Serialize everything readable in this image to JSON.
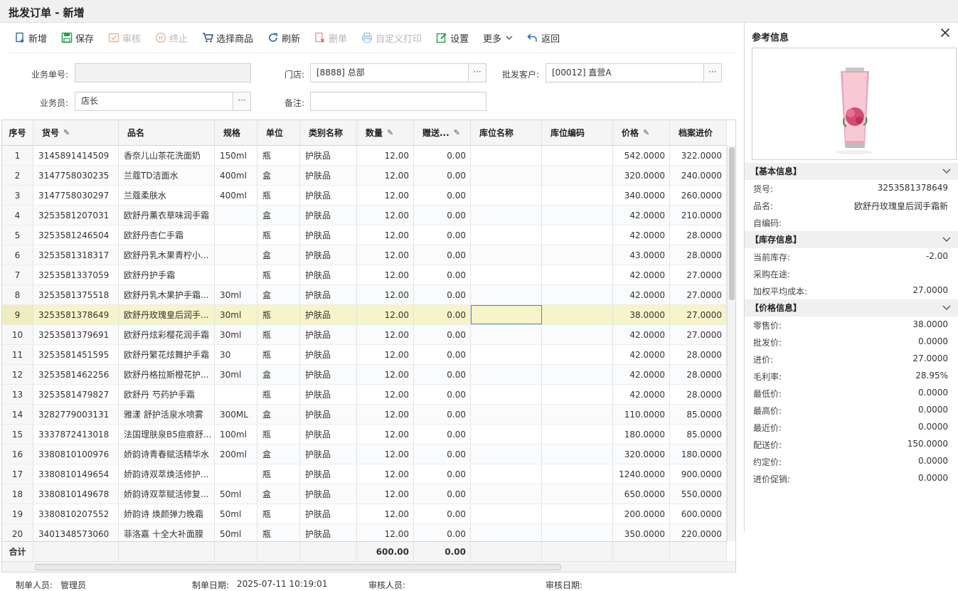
{
  "window": {
    "title": "批发订单 - 新增"
  },
  "toolbar": {
    "new": "新增",
    "save": "保存",
    "audit": "审核",
    "stop": "终止",
    "select_goods": "选择商品",
    "refresh": "刷新",
    "delete": "删单",
    "custom_print": "自定义打印",
    "settings": "设置",
    "more": "更多",
    "back": "返回"
  },
  "form": {
    "order_no_label": "业务单号:",
    "order_no": "",
    "store_label": "门店:",
    "store": "[8888] 总部",
    "customer_label": "批发客户:",
    "customer": "[00012] 直营A",
    "salesman_label": "业务员:",
    "salesman": "店长",
    "remark_label": "备注:",
    "remark": "",
    "dots": "···"
  },
  "grid": {
    "columns": [
      "序号",
      "货号",
      "品名",
      "规格",
      "单位",
      "类别名称",
      "数量",
      "赠送...",
      "库位名称",
      "库位编码",
      "价格",
      "档案进价"
    ],
    "edit_mark": "✎",
    "rows": [
      [
        "1",
        "3145891414509",
        "香奈儿山茶花洗面奶",
        "150ml",
        "瓶",
        "护肤品",
        "12.00",
        "0.00",
        "",
        "",
        "542.0000",
        "322.0000"
      ],
      [
        "2",
        "3147758030235",
        "兰蔻TD洁面水",
        "400ml",
        "盒",
        "护肤品",
        "12.00",
        "0.00",
        "",
        "",
        "320.0000",
        "240.0000"
      ],
      [
        "3",
        "3147758030297",
        "兰蔻柔肤水",
        "400ml",
        "瓶",
        "护肤品",
        "12.00",
        "0.00",
        "",
        "",
        "340.0000",
        "260.0000"
      ],
      [
        "4",
        "3253581207031",
        "欧舒丹薰衣草味润手霜",
        "",
        "盒",
        "护肤品",
        "12.00",
        "0.00",
        "",
        "",
        "42.0000",
        "210.0000"
      ],
      [
        "5",
        "3253581246504",
        "欧舒丹杏仁手霜",
        "",
        "瓶",
        "护肤品",
        "12.00",
        "0.00",
        "",
        "",
        "42.0000",
        "28.0000"
      ],
      [
        "6",
        "3253581318317",
        "欧舒丹乳木果青柠小...",
        "",
        "盒",
        "护肤品",
        "12.00",
        "0.00",
        "",
        "",
        "43.0000",
        "28.0000"
      ],
      [
        "7",
        "3253581337059",
        "欧舒丹护手霜",
        "",
        "瓶",
        "护肤品",
        "12.00",
        "0.00",
        "",
        "",
        "42.0000",
        "27.0000"
      ],
      [
        "8",
        "3253581375518",
        "欧舒丹乳木果护手霜...",
        "30ml",
        "盒",
        "护肤品",
        "12.00",
        "0.00",
        "",
        "",
        "42.0000",
        "27.0000"
      ],
      [
        "9",
        "3253581378649",
        "欧舒丹玫瑰皇后润手...",
        "30ml",
        "瓶",
        "护肤品",
        "12.00",
        "0.00",
        "",
        "",
        "38.0000",
        "27.0000"
      ],
      [
        "10",
        "3253581379691",
        "欧舒丹炫彩樱花润手霜",
        "30ml",
        "瓶",
        "护肤品",
        "12.00",
        "0.00",
        "",
        "",
        "42.0000",
        "27.0000"
      ],
      [
        "11",
        "3253581451595",
        "欧舒丹繁花炫舞护手霜",
        "30",
        "瓶",
        "护肤品",
        "12.00",
        "0.00",
        "",
        "",
        "42.0000",
        "28.0000"
      ],
      [
        "12",
        "3253581462256",
        "欧舒丹格拉斯橙花护...",
        "30ml",
        "盒",
        "护肤品",
        "12.00",
        "0.00",
        "",
        "",
        "42.0000",
        "28.0000"
      ],
      [
        "13",
        "3253581479827",
        "欧舒丹 芍药护手霜",
        "",
        "瓶",
        "护肤品",
        "12.00",
        "0.00",
        "",
        "",
        "42.0000",
        "28.0000"
      ],
      [
        "14",
        "3282779003131",
        "雅漾 舒护活泉水喷雾",
        "300ML",
        "盒",
        "护肤品",
        "12.00",
        "0.00",
        "",
        "",
        "110.0000",
        "85.0000"
      ],
      [
        "15",
        "3337872413018",
        "法国理肤泉B5痘痕舒...",
        "100ml",
        "瓶",
        "护肤品",
        "12.00",
        "0.00",
        "",
        "",
        "180.0000",
        "85.0000"
      ],
      [
        "16",
        "3380810100976",
        "娇韵诗青春赋活精华水",
        "200ml",
        "盒",
        "护肤品",
        "12.00",
        "0.00",
        "",
        "",
        "320.0000",
        "180.0000"
      ],
      [
        "17",
        "3380810149654",
        "娇韵诗双萃焕活修护...",
        "",
        "瓶",
        "护肤品",
        "12.00",
        "0.00",
        "",
        "",
        "1240.0000",
        "900.0000"
      ],
      [
        "18",
        "3380810149678",
        "娇韵诗双萃赋活修复...",
        "50ml",
        "盒",
        "护肤品",
        "12.00",
        "0.00",
        "",
        "",
        "650.0000",
        "550.0000"
      ],
      [
        "19",
        "3380810207552",
        "娇韵诗 焕颜弹力晚霜",
        "50ml",
        "瓶",
        "护肤品",
        "12.00",
        "0.00",
        "",
        "",
        "200.0000",
        "600.0000"
      ],
      [
        "20",
        "3401348573060",
        "菲洛嘉 十全大补面膜",
        "50ml",
        "瓶",
        "护肤品",
        "12.00",
        "0.00",
        "",
        "",
        "350.0000",
        "220.0000"
      ]
    ],
    "footer": {
      "label": "合计",
      "qty_total": "600.00",
      "gift_total": "0.00"
    }
  },
  "status": {
    "creator_label": "制单人员:",
    "creator": "管理员",
    "create_date_label": "制单日期:",
    "create_date": "2025-07-11 10:19:01",
    "auditor_label": "审核人员:",
    "auditor": "",
    "audit_date_label": "审核日期:",
    "audit_date": ""
  },
  "panel": {
    "title": "参考信息",
    "basic": {
      "header": "【基本信息】",
      "items": [
        [
          "货号:",
          "3253581378649"
        ],
        [
          "品名:",
          "欧舒丹玫瑰皇后润手霜新"
        ],
        [
          "自编码:",
          ""
        ]
      ]
    },
    "stock": {
      "header": "【库存信息】",
      "items": [
        [
          "当前库存:",
          "-2.00"
        ],
        [
          "采购在途:",
          ""
        ],
        [
          "加权平均成本:",
          "27.0000"
        ]
      ]
    },
    "price": {
      "header": "【价格信息】",
      "items": [
        [
          "零售价:",
          "38.0000"
        ],
        [
          "批发价:",
          "0.0000"
        ],
        [
          "进价:",
          "27.0000"
        ],
        [
          "毛利率:",
          "28.95%"
        ],
        [
          "最低价:",
          "0.0000"
        ],
        [
          "最高价:",
          "0.0000"
        ],
        [
          "最近价:",
          "0.0000"
        ],
        [
          "配送价:",
          "150.0000"
        ],
        [
          "约定价:",
          "0.0000"
        ],
        [
          "进价促销:",
          "0.0000"
        ]
      ]
    }
  },
  "colors": {
    "accent_blue": "#2b6cb0",
    "green": "#2e9b4e",
    "red": "#d9534f",
    "selected_row": "#f6f4c8"
  }
}
